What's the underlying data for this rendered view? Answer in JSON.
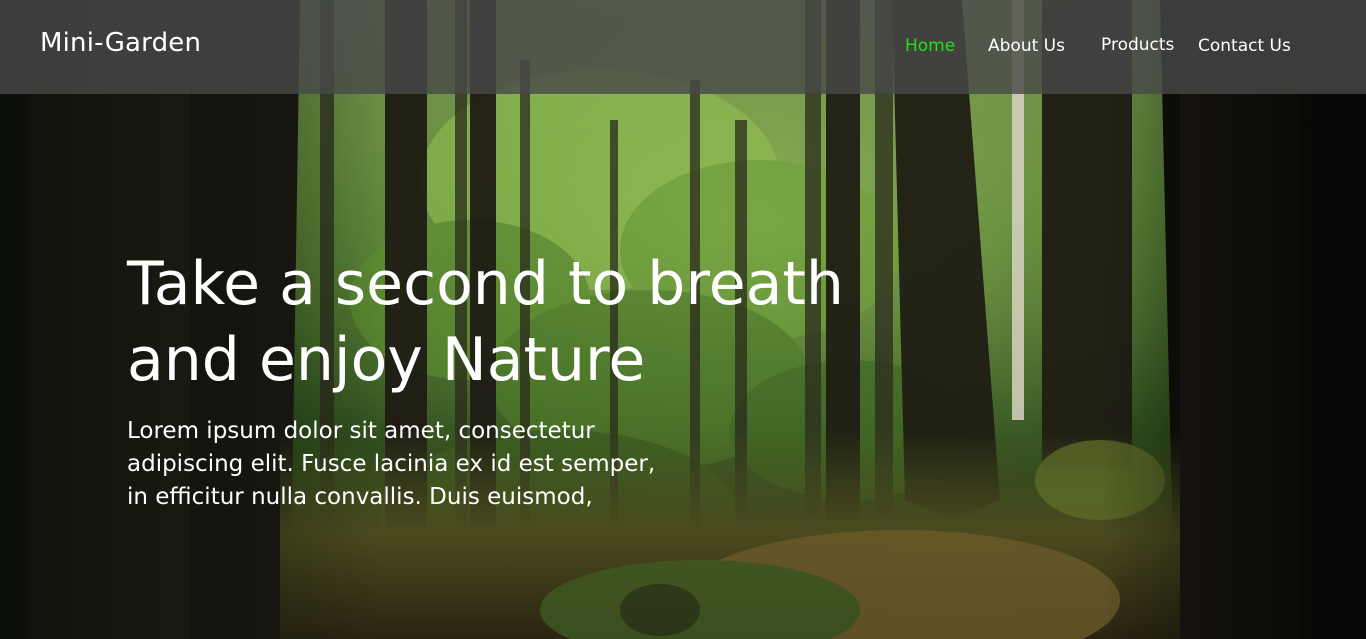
{
  "header": {
    "brand": "Mini-Garden",
    "nav": [
      {
        "label": "Home",
        "active": true
      },
      {
        "label": "About Us",
        "active": false
      },
      {
        "label": "Products",
        "active": false
      },
      {
        "label": "Contact Us",
        "active": false
      }
    ]
  },
  "hero": {
    "headline_lines": [
      "Take a second to breath",
      "and enjoy Nature"
    ],
    "body_lines": [
      "Lorem ipsum dolor sit amet, consectetur",
      "adipiscing elit. Fusce lacinia ex id est semper,",
      "in efficitur nulla convallis. Duis euismod,"
    ]
  },
  "colors": {
    "active_nav": "#22e11c",
    "header_bg": "rgba(72,72,72,0.80)",
    "text": "#ffffff"
  }
}
